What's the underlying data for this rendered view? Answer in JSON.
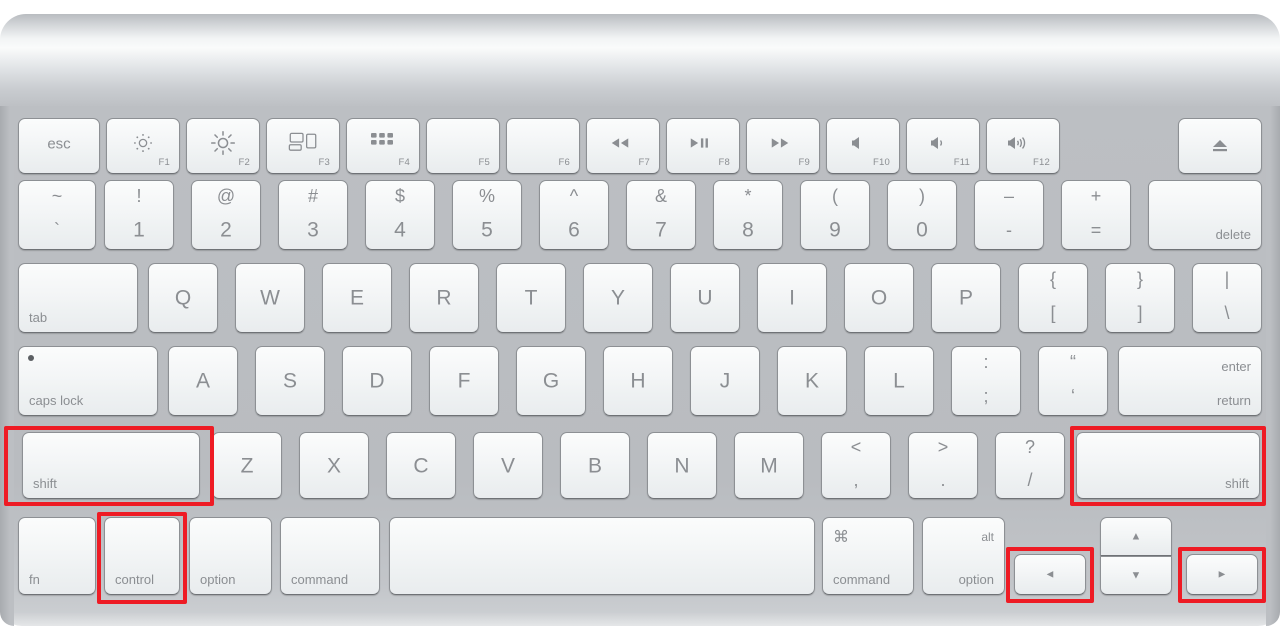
{
  "device": {
    "name": "Apple Wireless Keyboard",
    "body_color": "#bcbfc3",
    "key_color": "#f3f5f6",
    "key_text_color": "#8b8e92",
    "highlight_color": "#ee1b24"
  },
  "rows": {
    "function_row": [
      {
        "id": "esc",
        "label": "esc",
        "fn": ""
      },
      {
        "id": "f1",
        "label": "",
        "fn": "F1",
        "icon": "brightness-down-icon"
      },
      {
        "id": "f2",
        "label": "",
        "fn": "F2",
        "icon": "brightness-up-icon"
      },
      {
        "id": "f3",
        "label": "",
        "fn": "F3",
        "icon": "mission-control-icon"
      },
      {
        "id": "f4",
        "label": "",
        "fn": "F4",
        "icon": "launchpad-icon"
      },
      {
        "id": "f5",
        "label": "",
        "fn": "F5",
        "icon": ""
      },
      {
        "id": "f6",
        "label": "",
        "fn": "F6",
        "icon": ""
      },
      {
        "id": "f7",
        "label": "",
        "fn": "F7",
        "icon": "rewind-icon"
      },
      {
        "id": "f8",
        "label": "",
        "fn": "F8",
        "icon": "play-pause-icon"
      },
      {
        "id": "f9",
        "label": "",
        "fn": "F9",
        "icon": "fast-forward-icon"
      },
      {
        "id": "f10",
        "label": "",
        "fn": "F10",
        "icon": "mute-icon"
      },
      {
        "id": "f11",
        "label": "",
        "fn": "F11",
        "icon": "volume-down-icon"
      },
      {
        "id": "f12",
        "label": "",
        "fn": "F12",
        "icon": "volume-up-icon"
      },
      {
        "id": "eject",
        "label": "",
        "fn": "",
        "icon": "eject-icon"
      }
    ],
    "number_row": [
      {
        "id": "backtick",
        "top": "~",
        "bottom": "`"
      },
      {
        "id": "1",
        "top": "!",
        "bottom": "1"
      },
      {
        "id": "2",
        "top": "@",
        "bottom": "2"
      },
      {
        "id": "3",
        "top": "#",
        "bottom": "3"
      },
      {
        "id": "4",
        "top": "$",
        "bottom": "4"
      },
      {
        "id": "5",
        "top": "%",
        "bottom": "5"
      },
      {
        "id": "6",
        "top": "^",
        "bottom": "6"
      },
      {
        "id": "7",
        "top": "&",
        "bottom": "7"
      },
      {
        "id": "8",
        "top": "*",
        "bottom": "8"
      },
      {
        "id": "9",
        "top": "(",
        "bottom": "9"
      },
      {
        "id": "0",
        "top": ")",
        "bottom": "0"
      },
      {
        "id": "minus",
        "top": "–",
        "bottom": "-"
      },
      {
        "id": "equal",
        "top": "+",
        "bottom": "="
      },
      {
        "id": "delete",
        "top": "",
        "bottom": "delete"
      }
    ],
    "qwerty_row": [
      {
        "id": "tab",
        "label": "tab"
      },
      {
        "id": "q",
        "label": "Q"
      },
      {
        "id": "w",
        "label": "W"
      },
      {
        "id": "e",
        "label": "E"
      },
      {
        "id": "r",
        "label": "R"
      },
      {
        "id": "t",
        "label": "T"
      },
      {
        "id": "y",
        "label": "Y"
      },
      {
        "id": "u",
        "label": "U"
      },
      {
        "id": "i",
        "label": "I"
      },
      {
        "id": "o",
        "label": "O"
      },
      {
        "id": "p",
        "label": "P"
      },
      {
        "id": "bracketleft",
        "top": "{",
        "bottom": "["
      },
      {
        "id": "bracketright",
        "top": "}",
        "bottom": "]"
      },
      {
        "id": "backslash",
        "top": "|",
        "bottom": "\\"
      }
    ],
    "home_row": [
      {
        "id": "capslock",
        "label": "caps lock"
      },
      {
        "id": "a",
        "label": "A"
      },
      {
        "id": "s",
        "label": "S"
      },
      {
        "id": "d",
        "label": "D"
      },
      {
        "id": "f",
        "label": "F"
      },
      {
        "id": "g",
        "label": "G"
      },
      {
        "id": "h",
        "label": "H"
      },
      {
        "id": "j",
        "label": "J"
      },
      {
        "id": "k",
        "label": "K"
      },
      {
        "id": "l",
        "label": "L"
      },
      {
        "id": "semicolon",
        "top": ":",
        "bottom": ";"
      },
      {
        "id": "quote",
        "top": "“",
        "bottom": "‘"
      },
      {
        "id": "return",
        "top": "enter",
        "bottom": "return"
      }
    ],
    "shift_row": [
      {
        "id": "shift-left",
        "label": "shift",
        "highlighted": true
      },
      {
        "id": "z",
        "label": "Z"
      },
      {
        "id": "x",
        "label": "X"
      },
      {
        "id": "c",
        "label": "C"
      },
      {
        "id": "v",
        "label": "V"
      },
      {
        "id": "b",
        "label": "B"
      },
      {
        "id": "n",
        "label": "N"
      },
      {
        "id": "m",
        "label": "M"
      },
      {
        "id": "comma",
        "top": "<",
        "bottom": ","
      },
      {
        "id": "period",
        "top": ">",
        "bottom": "."
      },
      {
        "id": "slash",
        "top": "?",
        "bottom": "/"
      },
      {
        "id": "shift-right",
        "label": "shift",
        "highlighted": true
      }
    ],
    "bottom_row": [
      {
        "id": "fn",
        "label": "fn"
      },
      {
        "id": "control",
        "label": "control",
        "highlighted": true
      },
      {
        "id": "option-left",
        "label": "option"
      },
      {
        "id": "command-left",
        "label": "command"
      },
      {
        "id": "space",
        "label": ""
      },
      {
        "id": "command-right",
        "top": "⌘",
        "bottom": "command"
      },
      {
        "id": "option-right",
        "top": "alt",
        "bottom": "option"
      },
      {
        "id": "arrow-left",
        "label": "◄",
        "highlighted": true
      },
      {
        "id": "arrow-up",
        "label": "▲"
      },
      {
        "id": "arrow-down",
        "label": "▼"
      },
      {
        "id": "arrow-right",
        "label": "►",
        "highlighted": true
      }
    ]
  },
  "highlights": [
    {
      "target": "shift-left",
      "note": "highlighted"
    },
    {
      "target": "shift-right",
      "note": "highlighted"
    },
    {
      "target": "control",
      "note": "highlighted"
    },
    {
      "target": "arrow-left",
      "note": "highlighted"
    },
    {
      "target": "arrow-right",
      "note": "highlighted"
    }
  ]
}
